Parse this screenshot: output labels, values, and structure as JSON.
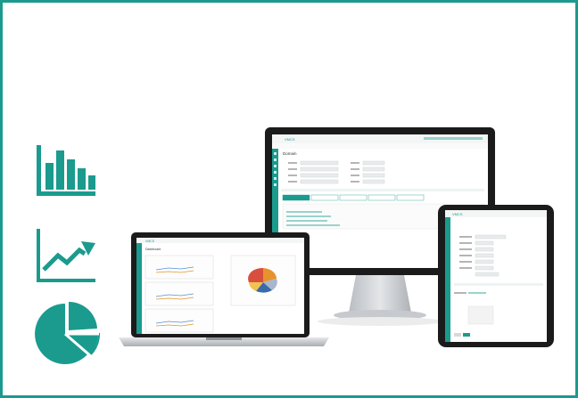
{
  "colors": {
    "brand_teal": "#1a9b8e",
    "frame_border": "#1a9b8e",
    "device_black": "#1b1b1b",
    "silver": "#c9ccd0"
  },
  "icons": {
    "bar_chart": "bar-chart-icon",
    "line_chart": "trend-line-icon",
    "pie_chart": "pie-chart-icon"
  },
  "devices": {
    "monitor": {
      "app_name": "VMCS",
      "section_title": "Domain"
    },
    "laptop": {
      "app_name": "VMCS",
      "section_title": "Dashboard"
    },
    "tablet": {
      "app_name": "VMCS"
    }
  }
}
